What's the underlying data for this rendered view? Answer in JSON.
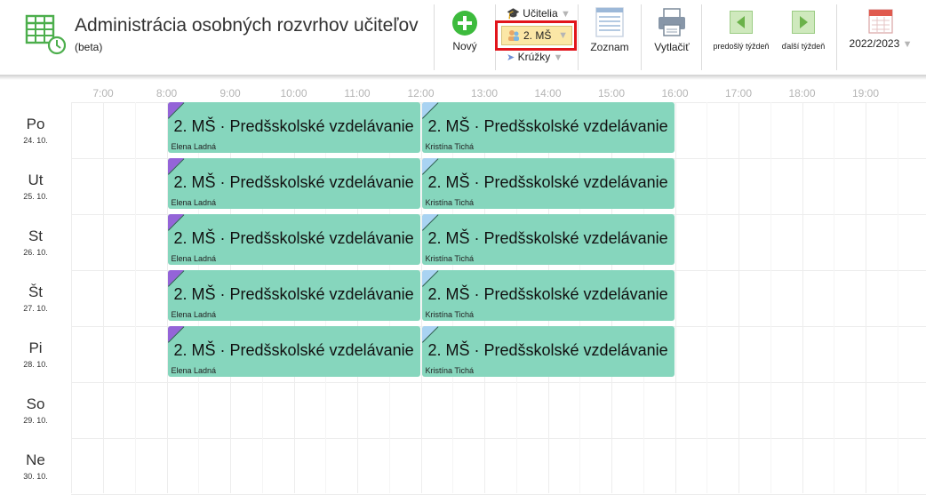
{
  "app": {
    "title": "Administrácia osobných rozvrhov učiteľov",
    "subtitle": "(beta)"
  },
  "toolbar": {
    "new_label": "Nový",
    "teachers_label": "Učitelia",
    "selected_class": "2. MŠ",
    "clubs_label": "Krúžky",
    "list_label": "Zoznam",
    "print_label": "Vytlačiť",
    "prev_week_label": "predošlý týždeň",
    "next_week_label": "ďalší týždeň",
    "school_year": "2022/2023"
  },
  "colors": {
    "event_bg": "#86d6bd",
    "corner_purple": "#9464d8",
    "corner_blue": "#a9d3f2",
    "highlight_border": "#e2141b",
    "selected_bg": "#fbe7a6"
  },
  "hours": [
    "7:00",
    "8:00",
    "9:00",
    "10:00",
    "11:00",
    "12:00",
    "13:00",
    "14:00",
    "15:00",
    "16:00",
    "17:00",
    "18:00",
    "19:00"
  ],
  "days": [
    {
      "name": "Po",
      "date": "24. 10."
    },
    {
      "name": "Ut",
      "date": "25. 10."
    },
    {
      "name": "St",
      "date": "26. 10."
    },
    {
      "name": "Št",
      "date": "27. 10."
    },
    {
      "name": "Pi",
      "date": "28. 10."
    },
    {
      "name": "So",
      "date": "29. 10."
    },
    {
      "name": "Ne",
      "date": "30. 10."
    }
  ],
  "events": [
    {
      "day": 0,
      "start": "8:00",
      "end": "12:00",
      "title": "2. MŠ · Predšskolské vzdelávanie",
      "teacher": "Elena Ladná",
      "corner": "purple"
    },
    {
      "day": 0,
      "start": "12:00",
      "end": "16:00",
      "title": "2. MŠ · Predšskolské vzdelávanie",
      "teacher": "Kristína Tichá",
      "corner": "blue"
    },
    {
      "day": 1,
      "start": "8:00",
      "end": "12:00",
      "title": "2. MŠ · Predšskolské vzdelávanie",
      "teacher": "Elena Ladná",
      "corner": "purple"
    },
    {
      "day": 1,
      "start": "12:00",
      "end": "16:00",
      "title": "2. MŠ · Predšskolské vzdelávanie",
      "teacher": "Kristína Tichá",
      "corner": "blue"
    },
    {
      "day": 2,
      "start": "8:00",
      "end": "12:00",
      "title": "2. MŠ · Predšskolské vzdelávanie",
      "teacher": "Elena Ladná",
      "corner": "purple"
    },
    {
      "day": 2,
      "start": "12:00",
      "end": "16:00",
      "title": "2. MŠ · Predšskolské vzdelávanie",
      "teacher": "Kristína Tichá",
      "corner": "blue"
    },
    {
      "day": 3,
      "start": "8:00",
      "end": "12:00",
      "title": "2. MŠ · Predšskolské vzdelávanie",
      "teacher": "Elena Ladná",
      "corner": "purple"
    },
    {
      "day": 3,
      "start": "12:00",
      "end": "16:00",
      "title": "2. MŠ · Predšskolské vzdelávanie",
      "teacher": "Kristína Tichá",
      "corner": "blue"
    },
    {
      "day": 4,
      "start": "8:00",
      "end": "12:00",
      "title": "2. MŠ · Predšskolské vzdelávanie",
      "teacher": "Elena Ladná",
      "corner": "purple"
    },
    {
      "day": 4,
      "start": "12:00",
      "end": "16:00",
      "title": "2. MŠ · Predšskolské vzdelávanie",
      "teacher": "Kristína Tichá",
      "corner": "blue"
    }
  ]
}
